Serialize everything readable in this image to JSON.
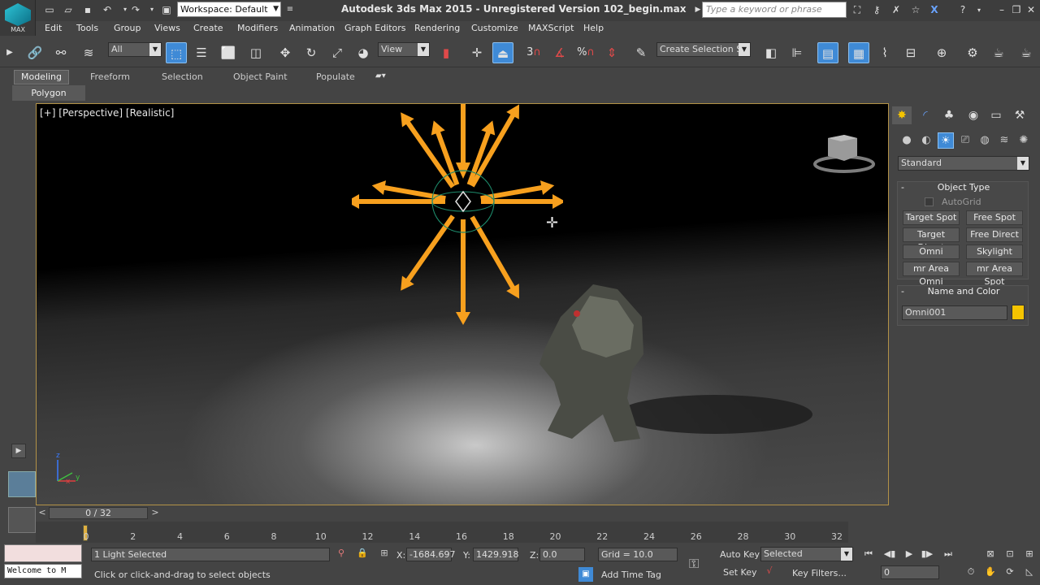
{
  "window": {
    "title": "Autodesk 3ds Max  2015  - Unregistered Version   102_begin.max",
    "logo_text": "MAX",
    "workspace": "Workspace: Default",
    "search_placeholder": "Type a keyword or phrase"
  },
  "menu": [
    "Edit",
    "Tools",
    "Group",
    "Views",
    "Create",
    "Modifiers",
    "Animation",
    "Graph Editors",
    "Rendering",
    "Customize",
    "MAXScript",
    "Help"
  ],
  "toolbar": {
    "selection_filter": "All",
    "reference_coord": "View",
    "named_selection": "Create Selection Se",
    "snap_labels": [
      "3",
      "%"
    ]
  },
  "ribbon": {
    "tabs": [
      "Modeling",
      "Freeform",
      "Selection",
      "Object Paint",
      "Populate"
    ],
    "active_panel": "Polygon Modeling"
  },
  "viewport": {
    "label": "[+] [Perspective] [Realistic]",
    "axis": {
      "z": "z",
      "x": "x",
      "y": "y"
    }
  },
  "command_panel": {
    "category": "Standard",
    "object_type_title": "Object Type",
    "autogrid": "AutoGrid",
    "buttons": [
      "Target Spot",
      "Free Spot",
      "Target Direct",
      "Free Direct",
      "Omni",
      "Skylight",
      "mr Area Omni",
      "mr Area Spot"
    ],
    "name_color_title": "Name and Color",
    "object_name": "Omni001",
    "object_color": "#f5c400"
  },
  "timeline": {
    "frame_display": "0 / 32",
    "prev": "<",
    "next": ">",
    "ticks": [
      "0",
      "2",
      "4",
      "6",
      "8",
      "10",
      "12",
      "14",
      "16",
      "18",
      "20",
      "22",
      "24",
      "26",
      "28",
      "30",
      "32"
    ]
  },
  "status": {
    "listener_text": "Welcome to M",
    "selection_info": "1 Light Selected",
    "prompt": "Click or click-and-drag to select objects",
    "x_label": "X:",
    "x_value": "-1684.697",
    "y_label": "Y:",
    "y_value": "1429.918",
    "z_label": "Z:",
    "z_value": "0.0",
    "grid": "Grid = 10.0",
    "add_time_tag": "Add Time Tag",
    "auto_key": "Auto Key",
    "set_key": "Set Key",
    "key_mode": "Selected",
    "key_filters": "Key Filters...",
    "current_frame": "0"
  },
  "colors": {
    "light_gizmo": "#f7a01e",
    "viewport_border": "#b39247",
    "active_tool": "#3f8ad6"
  }
}
